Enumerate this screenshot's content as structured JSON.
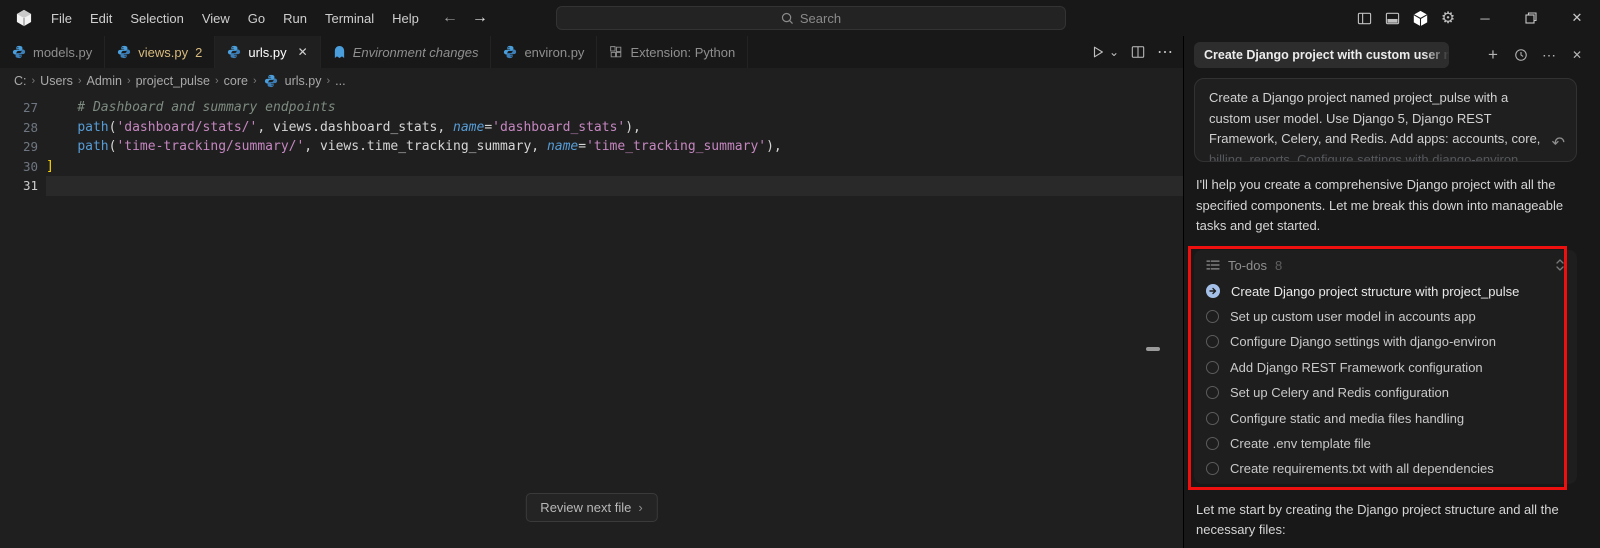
{
  "window": {
    "menu": [
      "File",
      "Edit",
      "Selection",
      "View",
      "Go",
      "Run",
      "Terminal",
      "Help"
    ],
    "search_placeholder": "Search"
  },
  "icons": {
    "back": "←",
    "forward": "→",
    "minimize": "─",
    "close": "✕",
    "gear": "⚙",
    "more": "⋯",
    "plus": "+",
    "chevron_down": "⌄",
    "chevron_right": "›",
    "undo": "↶",
    "tab_close": "✕"
  },
  "tabs": [
    {
      "label": "models.py",
      "icon": "python"
    },
    {
      "label": "views.py",
      "badge": "2",
      "icon": "python"
    },
    {
      "label": "urls.py",
      "icon": "python",
      "active": true
    },
    {
      "label": "Environment changes",
      "icon": "kiro-ghost",
      "italic": true
    },
    {
      "label": "environ.py",
      "icon": "python"
    },
    {
      "label": "Extension: Python",
      "icon": "extension"
    }
  ],
  "breadcrumb": [
    "C:",
    "Users",
    "Admin",
    "project_pulse",
    "core",
    "urls.py",
    "..."
  ],
  "editor": {
    "lines": [
      {
        "num": "27",
        "tokens": [
          {
            "t": "    # Dashboard and summary endpoints",
            "c": "comment"
          }
        ]
      },
      {
        "num": "28",
        "tokens": [
          {
            "t": "    ",
            "c": "plain"
          },
          {
            "t": "path",
            "c": "func"
          },
          {
            "t": "(",
            "c": "plain"
          },
          {
            "t": "'dashboard/stats/'",
            "c": "str"
          },
          {
            "t": ", ",
            "c": "plain"
          },
          {
            "t": "views.dashboard_stats",
            "c": "plain"
          },
          {
            "t": ", ",
            "c": "plain"
          },
          {
            "t": "name",
            "c": "param"
          },
          {
            "t": "=",
            "c": "plain"
          },
          {
            "t": "'dashboard_stats'",
            "c": "str"
          },
          {
            "t": "),",
            "c": "plain"
          }
        ]
      },
      {
        "num": "29",
        "tokens": [
          {
            "t": "    ",
            "c": "plain"
          },
          {
            "t": "path",
            "c": "func"
          },
          {
            "t": "(",
            "c": "plain"
          },
          {
            "t": "'time-tracking/summary/'",
            "c": "str"
          },
          {
            "t": ", ",
            "c": "plain"
          },
          {
            "t": "views.time_tracking_summary",
            "c": "plain"
          },
          {
            "t": ", ",
            "c": "plain"
          },
          {
            "t": "name",
            "c": "param"
          },
          {
            "t": "=",
            "c": "plain"
          },
          {
            "t": "'time_tracking_summary'",
            "c": "str"
          },
          {
            "t": "),",
            "c": "plain"
          }
        ]
      },
      {
        "num": "30",
        "tokens": [
          {
            "t": "]",
            "c": "bracket"
          }
        ]
      },
      {
        "num": "31",
        "tokens": [],
        "current": true
      }
    ],
    "review_button_label": "Review next file"
  },
  "chat": {
    "title": "Create Django project with custom user mod",
    "user_message_lines": [
      "Create a Django project named project_pulse with a",
      "custom user model. Use Django 5, Django REST",
      "Framework, Celery, and Redis. Add apps: accounts, core,",
      "billing, reports. Configure settings with django-environ"
    ],
    "assistant_intro": "I'll help you create a comprehensive Django project with all the specified components. Let me break this down into manageable tasks and get started.",
    "todos": {
      "label": "To-dos",
      "count": "8",
      "items": [
        {
          "text": "Create Django project structure with project_pulse",
          "status": "in_progress"
        },
        {
          "text": "Set up custom user model in accounts app",
          "status": "pending"
        },
        {
          "text": "Configure Django settings with django-environ",
          "status": "pending"
        },
        {
          "text": "Add Django REST Framework configuration",
          "status": "pending"
        },
        {
          "text": "Set up Celery and Redis configuration",
          "status": "pending"
        },
        {
          "text": "Configure static and media files handling",
          "status": "pending"
        },
        {
          "text": "Create .env template file",
          "status": "pending"
        },
        {
          "text": "Create requirements.txt with all dependencies",
          "status": "pending"
        }
      ]
    },
    "assistant_footer": "Let me start by creating the Django project structure and all the necessary files:"
  },
  "colors": {
    "annotation_red": "#ee0f0f",
    "editor_bg": "#1f1f1f",
    "panel_bg": "#181818",
    "string_pink": "#c586c0",
    "keyword_blue": "#569cd6",
    "bracket_gold": "#ffd700",
    "modified_tab_gold": "#d7ba7d",
    "python_icon_blue": "#4a9edc",
    "todo_progress_fill": "#a5c0e8"
  }
}
